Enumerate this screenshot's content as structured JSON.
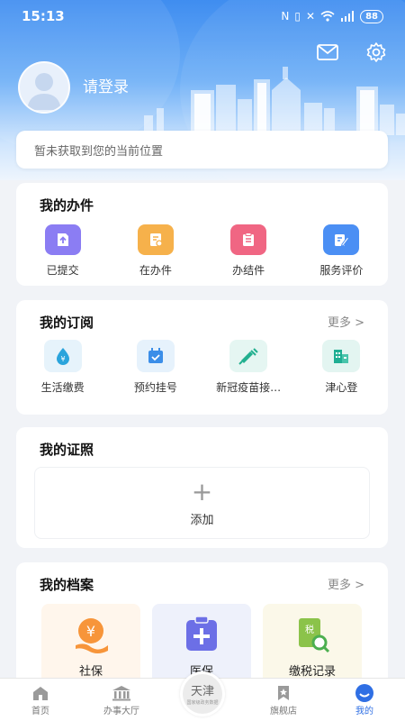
{
  "status": {
    "time": "15:13",
    "battery": "88"
  },
  "header": {
    "login_label": "请登录"
  },
  "location": {
    "text": "暂未获取到您的当前位置"
  },
  "my_tasks": {
    "title": "我的办件",
    "items": [
      {
        "label": "已提交",
        "icon": "upload-icon",
        "color": "#8b7df3"
      },
      {
        "label": "在办件",
        "icon": "document-icon",
        "color": "#f6b14b"
      },
      {
        "label": "办结件",
        "icon": "clipboard-icon",
        "color": "#f06683"
      },
      {
        "label": "服务评价",
        "icon": "edit-icon",
        "color": "#4b8ff4"
      }
    ]
  },
  "subscriptions": {
    "title": "我的订阅",
    "more": "更多 >",
    "items": [
      {
        "label": "生活缴费",
        "icon": "yuan-drop-icon"
      },
      {
        "label": "预约挂号",
        "icon": "calendar-check-icon"
      },
      {
        "label": "新冠疫苗接…",
        "icon": "syringe-icon"
      },
      {
        "label": "津心登",
        "icon": "building-icon"
      }
    ]
  },
  "licenses": {
    "title": "我的证照",
    "add_label": "添加"
  },
  "archives": {
    "title": "我的档案",
    "more": "更多 >",
    "items": [
      {
        "label": "社保",
        "icon": "social-security-icon"
      },
      {
        "label": "医保",
        "icon": "medical-insurance-icon"
      },
      {
        "label": "缴税记录",
        "icon": "tax-record-icon"
      }
    ]
  },
  "tabbar": {
    "items": [
      {
        "label": "首页",
        "icon": "home-icon"
      },
      {
        "label": "办事大厅",
        "icon": "hall-icon"
      },
      {
        "label": "旗舰店",
        "icon": "flag-icon"
      },
      {
        "label": "我的",
        "icon": "profile-icon"
      }
    ],
    "center_logo": "天津",
    "center_logo_small": "国家级政务数据",
    "active": "我的"
  },
  "colors": {
    "accent": "#2f6fe4",
    "header_blue": "#3f8df0"
  }
}
